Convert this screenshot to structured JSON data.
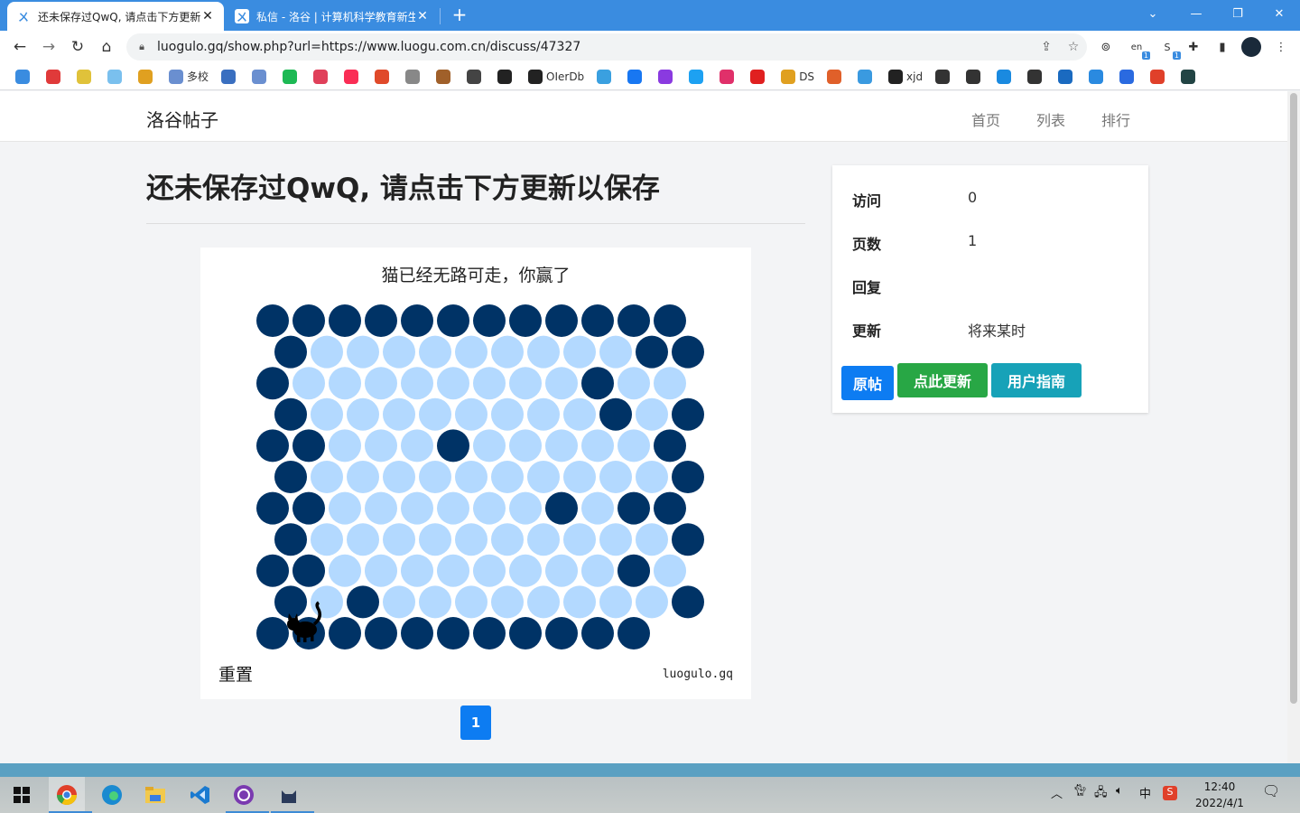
{
  "browser": {
    "tabs": [
      {
        "title": "还未保存过QwQ, 请点击下方更新",
        "active": true
      },
      {
        "title": "私信 - 洛谷 | 计算机科学教育新生",
        "active": false
      }
    ],
    "url": "luogulo.gq/show.php?url=https://www.luogu.com.cn/discuss/47327",
    "badges": {
      "ext_a": "1",
      "ext_b": "1"
    },
    "bookmarks": [
      {
        "label": "",
        "icon": "luogu-icon",
        "color": "#3a8ce0"
      },
      {
        "label": "",
        "icon": "slash-icon",
        "color": "#e03a3a"
      },
      {
        "label": "",
        "icon": "robot-icon",
        "color": "#e0c23a"
      },
      {
        "label": "",
        "icon": "drop-icon",
        "color": "#7ac0ee"
      },
      {
        "label": "",
        "icon": "key-icon",
        "color": "#e0a020"
      },
      {
        "label": "多校",
        "icon": "hdu-icon",
        "color": "#6a8fd0"
      },
      {
        "label": "",
        "icon": "poj-icon",
        "color": "#3a6fc0"
      },
      {
        "label": "",
        "icon": "hdu2-icon",
        "color": "#6a8fd0"
      },
      {
        "label": "",
        "icon": "spotify-icon",
        "color": "#1db954"
      },
      {
        "label": "",
        "icon": "mask-icon",
        "color": "#e0405a"
      },
      {
        "label": "",
        "icon": "music-icon",
        "color": "#fa2d55"
      },
      {
        "label": "",
        "icon": "chart-icon",
        "color": "#e04a2a"
      },
      {
        "label": "",
        "icon": "bird-icon",
        "color": "#888888"
      },
      {
        "label": "",
        "icon": "monkey-icon",
        "color": "#a0602a"
      },
      {
        "label": "",
        "icon": "gear-icon",
        "color": "#444444"
      },
      {
        "label": "",
        "icon": "cap-icon",
        "color": "#222222"
      },
      {
        "label": "OIerDb",
        "icon": "globe-icon",
        "color": "#222222"
      },
      {
        "label": "",
        "icon": "bilibili-icon",
        "color": "#3aa0e0"
      },
      {
        "label": "",
        "icon": "facebook-icon",
        "color": "#1877f2"
      },
      {
        "label": "",
        "icon": "messenger-icon",
        "color": "#8a3ae0"
      },
      {
        "label": "",
        "icon": "twitter-icon",
        "color": "#1da1f2"
      },
      {
        "label": "",
        "icon": "instagram-icon",
        "color": "#e0306a"
      },
      {
        "label": "",
        "icon": "youtube-icon",
        "color": "#e02020"
      },
      {
        "label": "DS",
        "icon": "ds-icon",
        "color": "#e0a020"
      },
      {
        "label": "",
        "icon": "weibo-icon",
        "color": "#e0602a"
      },
      {
        "label": "",
        "icon": "flutter-icon",
        "color": "#3a9ae0"
      },
      {
        "label": "xjd",
        "icon": "github-icon",
        "color": "#222222"
      },
      {
        "label": "",
        "icon": "cat-icon",
        "color": "#333333"
      },
      {
        "label": "",
        "icon": "cat2-icon",
        "color": "#333333"
      },
      {
        "label": "",
        "icon": "cloud-icon",
        "color": "#1a8ae0"
      },
      {
        "label": "",
        "icon": "cat3-icon",
        "color": "#333333"
      },
      {
        "label": "",
        "icon": "cloud2-icon",
        "color": "#1a6ac0"
      },
      {
        "label": "",
        "icon": "e-icon",
        "color": "#2a8ae0"
      },
      {
        "label": "",
        "icon": "c-icon",
        "color": "#2a6ae0"
      },
      {
        "label": "",
        "icon": "ting-icon",
        "color": "#e0402a"
      },
      {
        "label": "",
        "icon": "dark-icon",
        "color": "#224444"
      }
    ]
  },
  "site": {
    "brand": "洛谷帖子",
    "nav": [
      "首页",
      "列表",
      "排行"
    ]
  },
  "post": {
    "title": "还未保存过QwQ, 请点击下方更新以保存"
  },
  "game": {
    "message": "猫已经无路可走，你赢了",
    "reset_label": "重置",
    "credit": "luogulo.gq",
    "colors": {
      "blocked": "#003366",
      "open": "#b3d9ff"
    },
    "cat_position": [
      10,
      1
    ],
    "rows": [
      "XXXXXXXXXXXX",
      "X.........XX",
      "X........X..",
      "X........X.X",
      "XX...X.....X",
      "X..........X",
      "XX......X.XX",
      "X..........X",
      "XX........X.",
      "X.X........X",
      "XXXXXXXXXXX"
    ]
  },
  "pagination": {
    "current": "1"
  },
  "stats": {
    "rows": [
      {
        "label": "访问",
        "value": "0"
      },
      {
        "label": "页数",
        "value": "1"
      },
      {
        "label": "回复",
        "value": ""
      },
      {
        "label": "更新",
        "value": "将来某时"
      }
    ],
    "buttons": [
      {
        "label": "原帖",
        "color": "#0d7cf2"
      },
      {
        "label": "点此更新",
        "color": "#28a745"
      },
      {
        "label": "用户指南",
        "color": "#17a2b8"
      }
    ]
  },
  "taskbar": {
    "ime": "中",
    "time": "12:40",
    "date": "2022/4/1"
  }
}
